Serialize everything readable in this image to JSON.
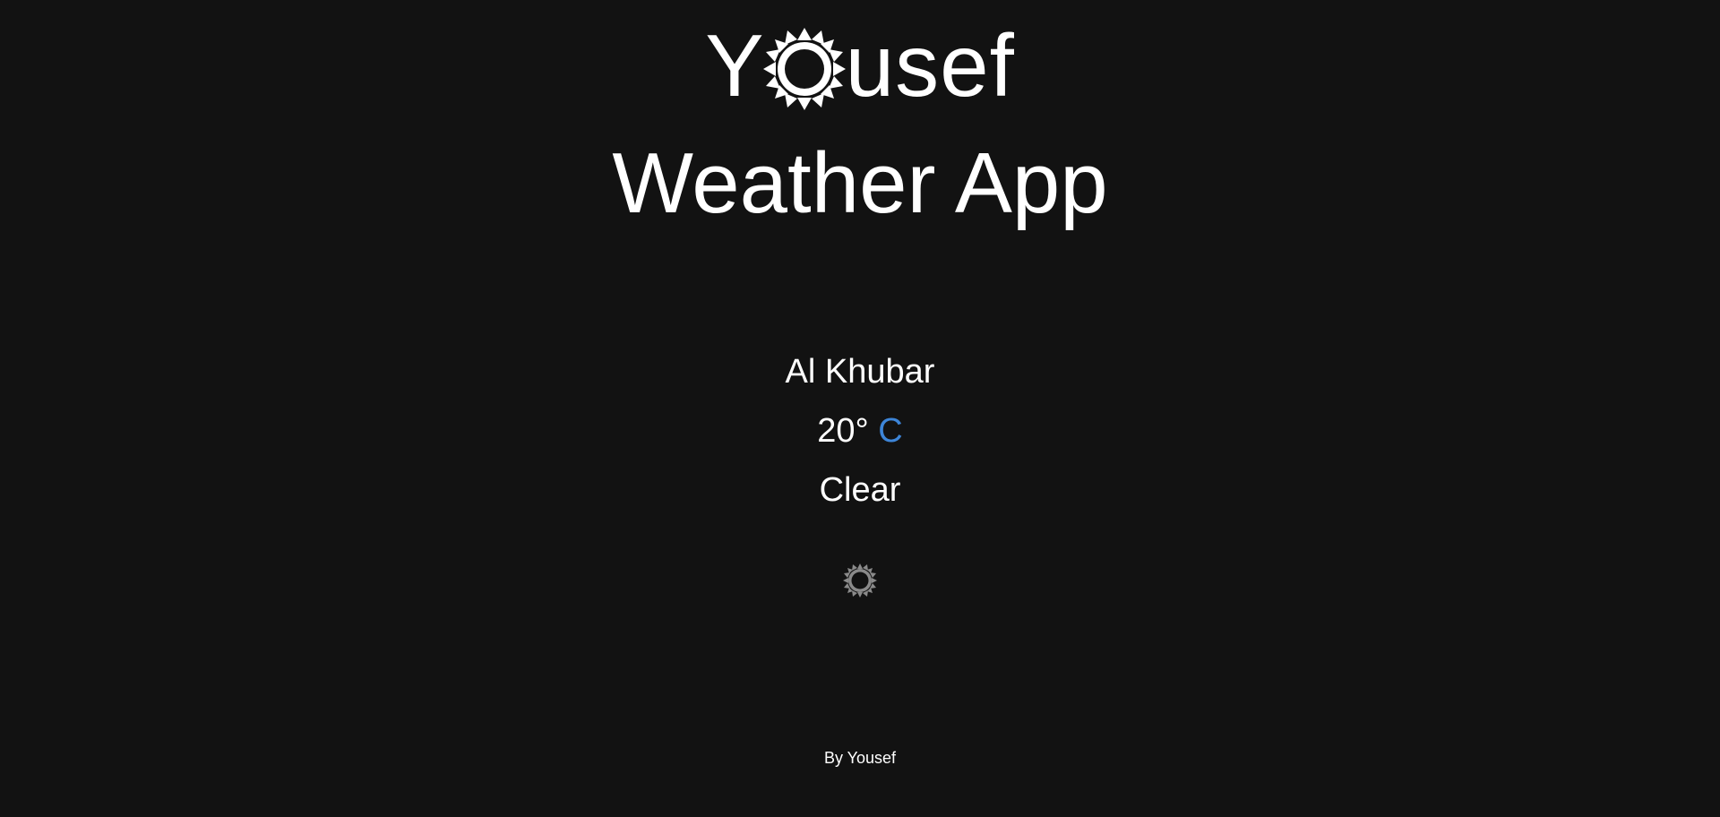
{
  "header": {
    "brand_prefix": "Y",
    "brand_icon": "sun-icon",
    "brand_suffix": "usef",
    "app_title": "Weather App"
  },
  "weather": {
    "city": "Al Khubar",
    "temperature": "20°",
    "unit": "C",
    "condition": "Clear",
    "icon": "sun-icon"
  },
  "footer": {
    "credit": "By Yousef"
  },
  "colors": {
    "background": "#121212",
    "text": "#ffffff",
    "accent": "#3d85d8",
    "icon_muted": "#8a8a8a"
  }
}
